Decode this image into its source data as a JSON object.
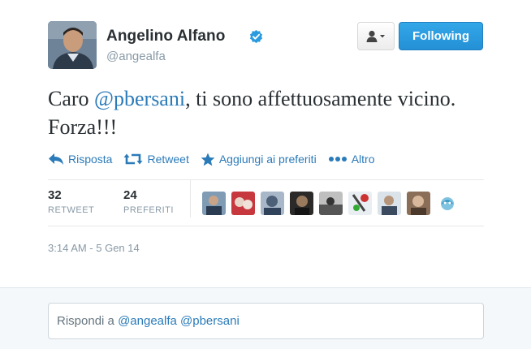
{
  "user": {
    "display_name": "Angelino Alfano",
    "handle": "@angealfa",
    "verified": true
  },
  "header": {
    "follow_label": "Following"
  },
  "tweet": {
    "text_before": "Caro ",
    "mention": "@pbersani",
    "text_after": ", ti sono affettuosamente vicino. Forza!!!"
  },
  "actions": {
    "reply": "Risposta",
    "retweet": "Retweet",
    "favorite": "Aggiungi ai preferiti",
    "more": "Altro"
  },
  "stats": {
    "retweets": {
      "count": "32",
      "label": "RETWEET"
    },
    "favorites": {
      "count": "24",
      "label": "PREFERITI"
    }
  },
  "timestamp": "3:14 AM - 5 Gen 14",
  "reply": {
    "placeholder_prefix": "Rispondi a ",
    "mentions": "@angealfa @pbersani"
  },
  "colors": {
    "link": "#2b7bb9",
    "follow_button": "#2b9be0",
    "muted": "#8899a6"
  },
  "icons": {
    "verified": "verified-badge-icon",
    "user_menu": "user-dropdown-icon",
    "reply": "reply-arrow-icon",
    "retweet": "retweet-icon",
    "favorite": "star-icon",
    "more": "ellipsis-icon"
  }
}
